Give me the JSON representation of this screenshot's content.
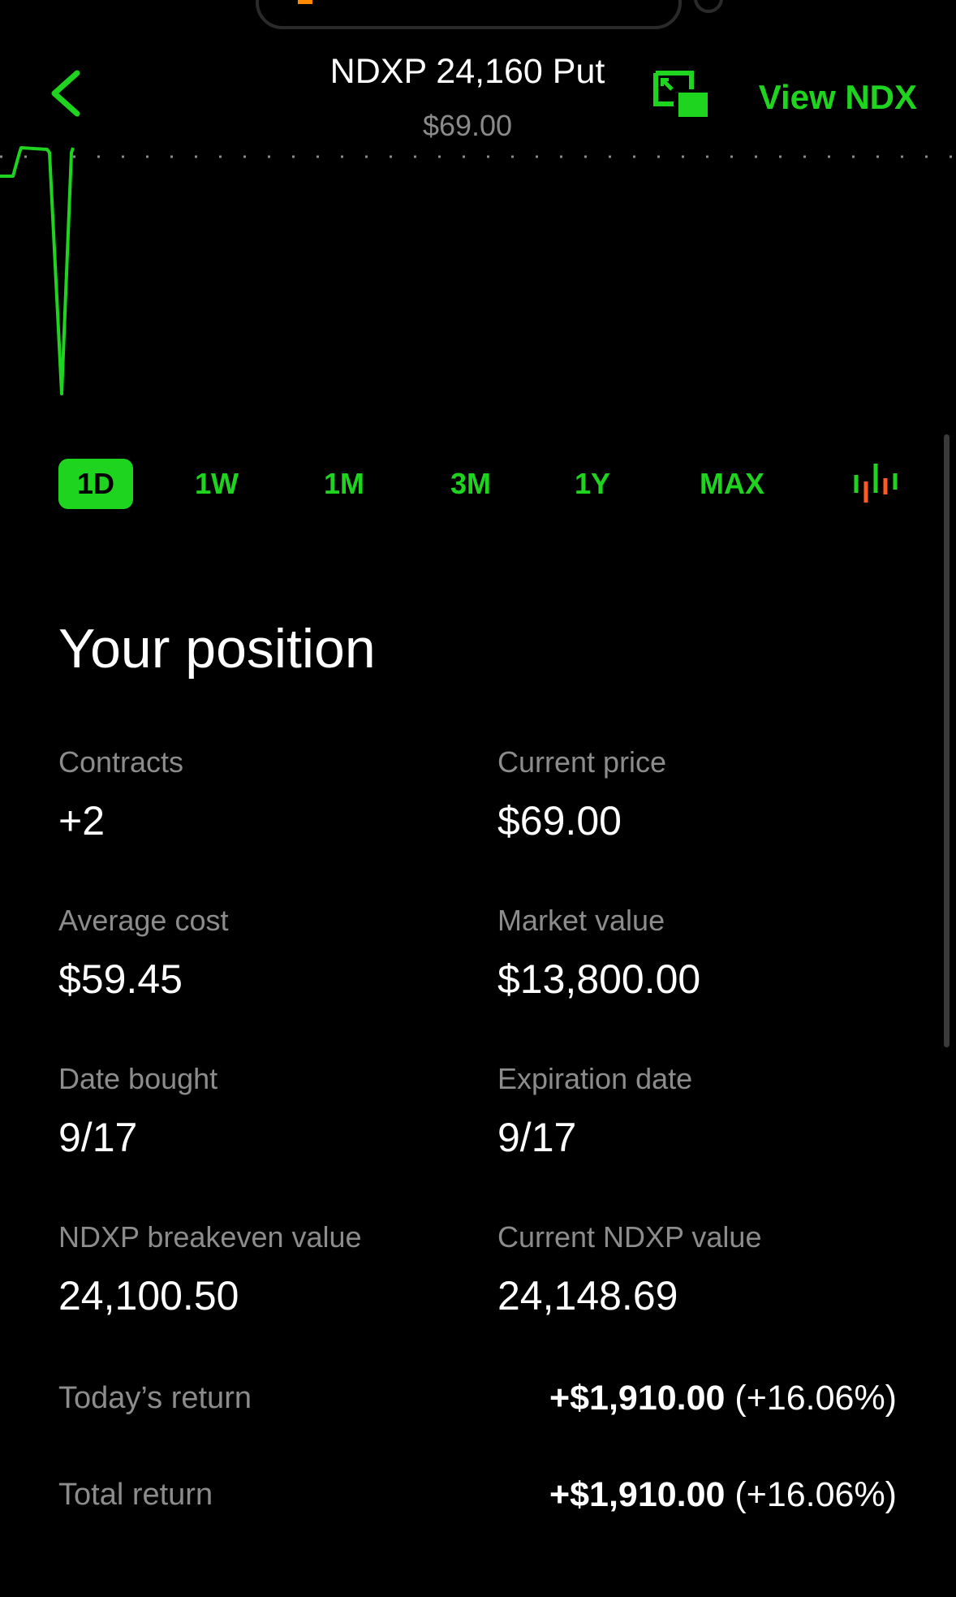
{
  "header": {
    "title": "NDXP 24,160 Put",
    "subtitle": "$69.00",
    "view_button": "View NDX"
  },
  "colors": {
    "accent": "#1fd41f",
    "background": "#000000",
    "muted": "#8c8c8c",
    "candle_down": "#ff5a1f"
  },
  "icons": {
    "back": "chevron-left-icon",
    "pip": "picture-in-picture-icon",
    "candles": "candlestick-chart-icon"
  },
  "ranges": {
    "items": [
      "1D",
      "1W",
      "1M",
      "3M",
      "1Y",
      "MAX"
    ],
    "selected": "1D"
  },
  "position": {
    "title": "Your position",
    "contracts_label": "Contracts",
    "contracts_value": "+2",
    "current_price_label": "Current price",
    "current_price_value": "$69.00",
    "avg_cost_label": "Average cost",
    "avg_cost_value": "$59.45",
    "market_value_label": "Market value",
    "market_value_value": "$13,800.00",
    "date_bought_label": "Date bought",
    "date_bought_value": "9/17",
    "expiration_label": "Expiration date",
    "expiration_value": "9/17",
    "breakeven_label": "NDXP breakeven value",
    "breakeven_value": "24,100.50",
    "current_ndxp_label": "Current NDXP value",
    "current_ndxp_value": "24,148.69"
  },
  "returns": {
    "today_label": "Today’s return",
    "today_amount": "+$1,910.00",
    "today_pct": "(+16.06%)",
    "total_label": "Total return",
    "total_amount": "+$1,910.00",
    "total_pct": "(+16.06%)"
  }
}
